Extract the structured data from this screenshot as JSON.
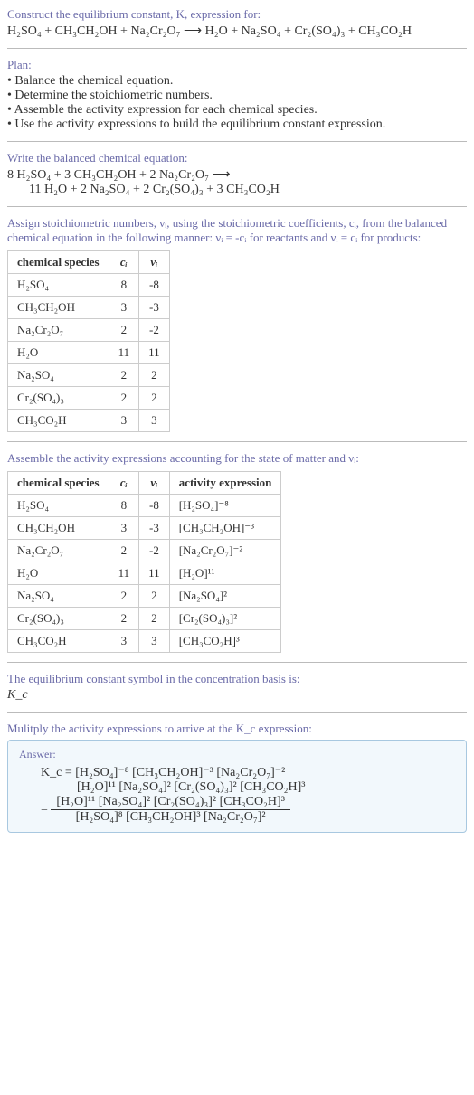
{
  "top": {
    "heading": "Construct the equilibrium constant, K, expression for:",
    "equation": "H₂SO₄ + CH₃CH₂OH + Na₂Cr₂O₇ ⟶ H₂O + Na₂SO₄ + Cr₂(SO₄)₃ + CH₃CO₂H"
  },
  "plan": {
    "heading": "Plan:",
    "items": [
      "Balance the chemical equation.",
      "Determine the stoichiometric numbers.",
      "Assemble the activity expression for each chemical species.",
      "Use the activity expressions to build the equilibrium constant expression."
    ]
  },
  "balanced": {
    "heading": "Write the balanced chemical equation:",
    "line1": "8 H₂SO₄ + 3 CH₃CH₂OH + 2 Na₂Cr₂O₇ ⟶",
    "line2": "11 H₂O + 2 Na₂SO₄ + 2 Cr₂(SO₄)₃ + 3 CH₃CO₂H"
  },
  "stoich": {
    "heading": "Assign stoichiometric numbers, νᵢ, using the stoichiometric coefficients, cᵢ, from the balanced chemical equation in the following manner: νᵢ = -cᵢ for reactants and νᵢ = cᵢ for products:",
    "headers": [
      "chemical species",
      "cᵢ",
      "νᵢ"
    ],
    "rows": [
      [
        "H₂SO₄",
        "8",
        "-8"
      ],
      [
        "CH₃CH₂OH",
        "3",
        "-3"
      ],
      [
        "Na₂Cr₂O₇",
        "2",
        "-2"
      ],
      [
        "H₂O",
        "11",
        "11"
      ],
      [
        "Na₂SO₄",
        "2",
        "2"
      ],
      [
        "Cr₂(SO₄)₃",
        "2",
        "2"
      ],
      [
        "CH₃CO₂H",
        "3",
        "3"
      ]
    ]
  },
  "activity": {
    "heading": "Assemble the activity expressions accounting for the state of matter and νᵢ:",
    "headers": [
      "chemical species",
      "cᵢ",
      "νᵢ",
      "activity expression"
    ],
    "rows": [
      [
        "H₂SO₄",
        "8",
        "-8",
        "[H₂SO₄]⁻⁸"
      ],
      [
        "CH₃CH₂OH",
        "3",
        "-3",
        "[CH₃CH₂OH]⁻³"
      ],
      [
        "Na₂Cr₂O₇",
        "2",
        "-2",
        "[Na₂Cr₂O₇]⁻²"
      ],
      [
        "H₂O",
        "11",
        "11",
        "[H₂O]¹¹"
      ],
      [
        "Na₂SO₄",
        "2",
        "2",
        "[Na₂SO₄]²"
      ],
      [
        "Cr₂(SO₄)₃",
        "2",
        "2",
        "[Cr₂(SO₄)₃]²"
      ],
      [
        "CH₃CO₂H",
        "3",
        "3",
        "[CH₃CO₂H]³"
      ]
    ]
  },
  "eqsym": {
    "heading": "The equilibrium constant symbol in the concentration basis is:",
    "value": "K_c"
  },
  "mult": {
    "heading": "Mulitply the activity expressions to arrive at the K_c expression:"
  },
  "answer": {
    "label": "Answer:",
    "line1": "K_c = [H₂SO₄]⁻⁸ [CH₃CH₂OH]⁻³ [Na₂Cr₂O₇]⁻²",
    "line2": "[H₂O]¹¹ [Na₂SO₄]² [Cr₂(SO₄)₃]² [CH₃CO₂H]³",
    "frac_num": "[H₂O]¹¹ [Na₂SO₄]² [Cr₂(SO₄)₃]² [CH₃CO₂H]³",
    "frac_den": "[H₂SO₄]⁸ [CH₃CH₂OH]³ [Na₂Cr₂O₇]²",
    "equals": "= "
  }
}
